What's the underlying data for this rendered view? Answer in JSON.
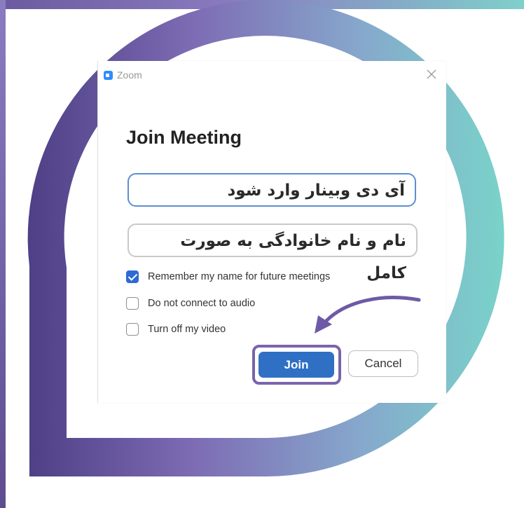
{
  "colors": {
    "accent": "#2f70c4",
    "frame_purple": "#6b5aa0",
    "frame_teal": "#7fd0cb",
    "highlight": "#7b64aa"
  },
  "window": {
    "app_icon": "zoom-logo-icon",
    "title": "Zoom",
    "close_icon": "close-icon"
  },
  "dialog": {
    "heading": "Join Meeting",
    "meeting_id_field": "آی دی وبینار وارد شود",
    "name_field": "نام و نام خانوادگی به صورت کامل",
    "options": [
      {
        "label": "Remember my name for future meetings",
        "checked": true
      },
      {
        "label": "Do not connect to audio",
        "checked": false
      },
      {
        "label": "Turn off my video",
        "checked": false
      }
    ],
    "join_label": "Join",
    "cancel_label": "Cancel"
  }
}
